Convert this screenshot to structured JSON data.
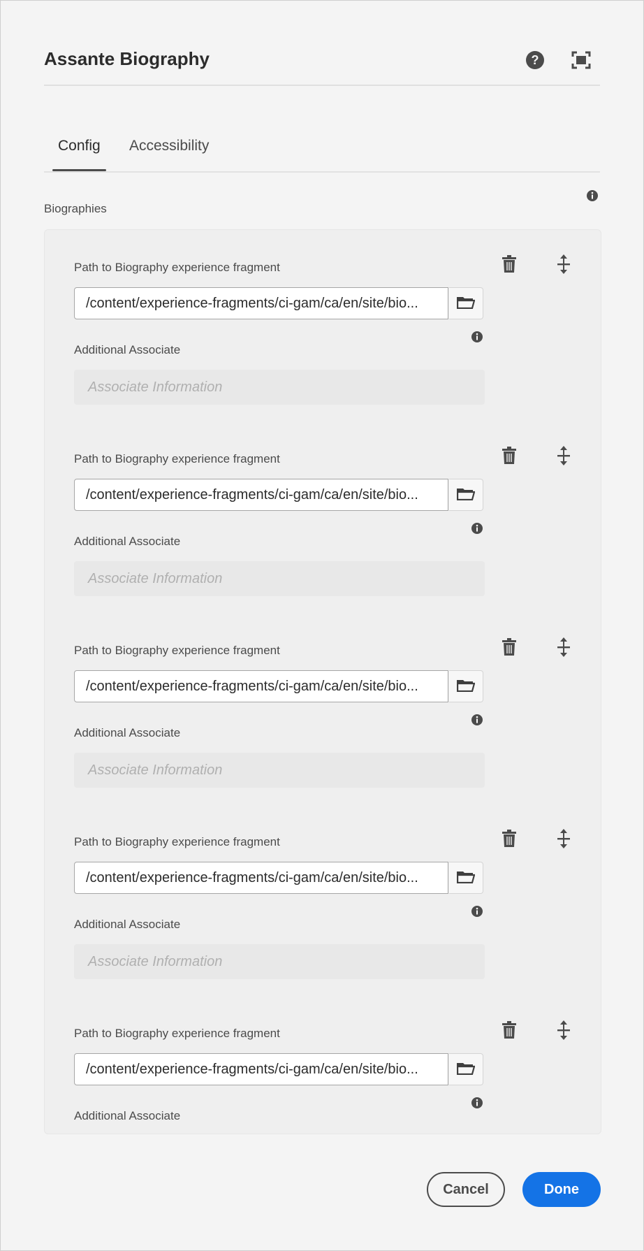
{
  "dialog": {
    "title": "Assante Biography",
    "tabs": [
      {
        "label": "Config",
        "active": true
      },
      {
        "label": "Accessibility",
        "active": false
      }
    ]
  },
  "multifield": {
    "label": "Biographies",
    "items": [
      {
        "path_label": "Path to Biography experience fragment",
        "path_value": "/content/experience-fragments/ci-gam/ca/en/site/bio...",
        "assoc_label": "Additional Associate",
        "assoc_placeholder": "Associate Information"
      },
      {
        "path_label": "Path to Biography experience fragment",
        "path_value": "/content/experience-fragments/ci-gam/ca/en/site/bio...",
        "assoc_label": "Additional Associate",
        "assoc_placeholder": "Associate Information"
      },
      {
        "path_label": "Path to Biography experience fragment",
        "path_value": "/content/experience-fragments/ci-gam/ca/en/site/bio...",
        "assoc_label": "Additional Associate",
        "assoc_placeholder": "Associate Information"
      },
      {
        "path_label": "Path to Biography experience fragment",
        "path_value": "/content/experience-fragments/ci-gam/ca/en/site/bio...",
        "assoc_label": "Additional Associate",
        "assoc_placeholder": "Associate Information"
      },
      {
        "path_label": "Path to Biography experience fragment",
        "path_value": "/content/experience-fragments/ci-gam/ca/en/site/bio...",
        "assoc_label": "Additional Associate",
        "assoc_placeholder": ""
      }
    ]
  },
  "footer": {
    "cancel_label": "Cancel",
    "done_label": "Done"
  },
  "icons": {
    "help": "help-circle-icon",
    "fullscreen": "fullscreen-icon",
    "info": "info-icon",
    "browse": "folder-icon",
    "delete": "trash-icon",
    "reorder": "move-vertical-icon"
  },
  "colors": {
    "primary": "#1473e6",
    "background": "#f4f4f4",
    "panel": "#efefef",
    "text": "#2c2c2c"
  }
}
